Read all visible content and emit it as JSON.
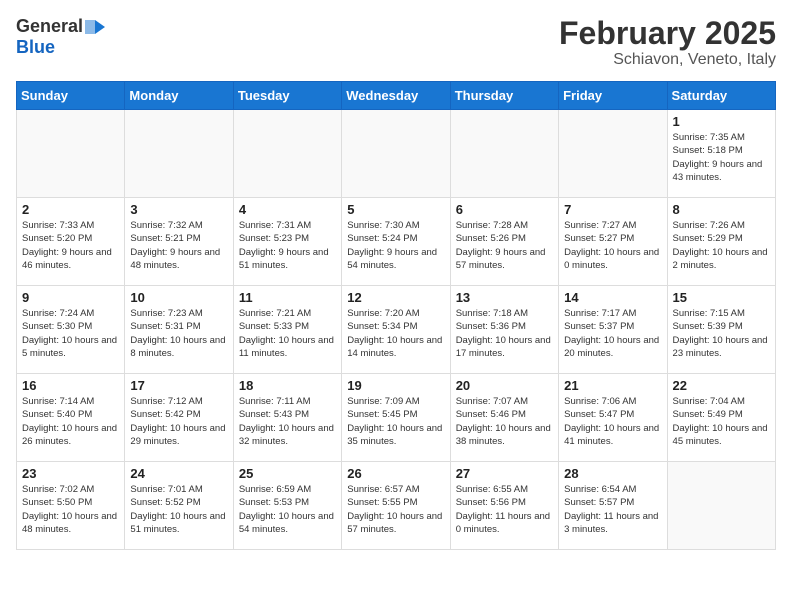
{
  "header": {
    "logo_general": "General",
    "logo_blue": "Blue",
    "month_title": "February 2025",
    "subtitle": "Schiavon, Veneto, Italy"
  },
  "days_of_week": [
    "Sunday",
    "Monday",
    "Tuesday",
    "Wednesday",
    "Thursday",
    "Friday",
    "Saturday"
  ],
  "weeks": [
    [
      {
        "day": "",
        "info": ""
      },
      {
        "day": "",
        "info": ""
      },
      {
        "day": "",
        "info": ""
      },
      {
        "day": "",
        "info": ""
      },
      {
        "day": "",
        "info": ""
      },
      {
        "day": "",
        "info": ""
      },
      {
        "day": "1",
        "info": "Sunrise: 7:35 AM\nSunset: 5:18 PM\nDaylight: 9 hours and 43 minutes."
      }
    ],
    [
      {
        "day": "2",
        "info": "Sunrise: 7:33 AM\nSunset: 5:20 PM\nDaylight: 9 hours and 46 minutes."
      },
      {
        "day": "3",
        "info": "Sunrise: 7:32 AM\nSunset: 5:21 PM\nDaylight: 9 hours and 48 minutes."
      },
      {
        "day": "4",
        "info": "Sunrise: 7:31 AM\nSunset: 5:23 PM\nDaylight: 9 hours and 51 minutes."
      },
      {
        "day": "5",
        "info": "Sunrise: 7:30 AM\nSunset: 5:24 PM\nDaylight: 9 hours and 54 minutes."
      },
      {
        "day": "6",
        "info": "Sunrise: 7:28 AM\nSunset: 5:26 PM\nDaylight: 9 hours and 57 minutes."
      },
      {
        "day": "7",
        "info": "Sunrise: 7:27 AM\nSunset: 5:27 PM\nDaylight: 10 hours and 0 minutes."
      },
      {
        "day": "8",
        "info": "Sunrise: 7:26 AM\nSunset: 5:29 PM\nDaylight: 10 hours and 2 minutes."
      }
    ],
    [
      {
        "day": "9",
        "info": "Sunrise: 7:24 AM\nSunset: 5:30 PM\nDaylight: 10 hours and 5 minutes."
      },
      {
        "day": "10",
        "info": "Sunrise: 7:23 AM\nSunset: 5:31 PM\nDaylight: 10 hours and 8 minutes."
      },
      {
        "day": "11",
        "info": "Sunrise: 7:21 AM\nSunset: 5:33 PM\nDaylight: 10 hours and 11 minutes."
      },
      {
        "day": "12",
        "info": "Sunrise: 7:20 AM\nSunset: 5:34 PM\nDaylight: 10 hours and 14 minutes."
      },
      {
        "day": "13",
        "info": "Sunrise: 7:18 AM\nSunset: 5:36 PM\nDaylight: 10 hours and 17 minutes."
      },
      {
        "day": "14",
        "info": "Sunrise: 7:17 AM\nSunset: 5:37 PM\nDaylight: 10 hours and 20 minutes."
      },
      {
        "day": "15",
        "info": "Sunrise: 7:15 AM\nSunset: 5:39 PM\nDaylight: 10 hours and 23 minutes."
      }
    ],
    [
      {
        "day": "16",
        "info": "Sunrise: 7:14 AM\nSunset: 5:40 PM\nDaylight: 10 hours and 26 minutes."
      },
      {
        "day": "17",
        "info": "Sunrise: 7:12 AM\nSunset: 5:42 PM\nDaylight: 10 hours and 29 minutes."
      },
      {
        "day": "18",
        "info": "Sunrise: 7:11 AM\nSunset: 5:43 PM\nDaylight: 10 hours and 32 minutes."
      },
      {
        "day": "19",
        "info": "Sunrise: 7:09 AM\nSunset: 5:45 PM\nDaylight: 10 hours and 35 minutes."
      },
      {
        "day": "20",
        "info": "Sunrise: 7:07 AM\nSunset: 5:46 PM\nDaylight: 10 hours and 38 minutes."
      },
      {
        "day": "21",
        "info": "Sunrise: 7:06 AM\nSunset: 5:47 PM\nDaylight: 10 hours and 41 minutes."
      },
      {
        "day": "22",
        "info": "Sunrise: 7:04 AM\nSunset: 5:49 PM\nDaylight: 10 hours and 45 minutes."
      }
    ],
    [
      {
        "day": "23",
        "info": "Sunrise: 7:02 AM\nSunset: 5:50 PM\nDaylight: 10 hours and 48 minutes."
      },
      {
        "day": "24",
        "info": "Sunrise: 7:01 AM\nSunset: 5:52 PM\nDaylight: 10 hours and 51 minutes."
      },
      {
        "day": "25",
        "info": "Sunrise: 6:59 AM\nSunset: 5:53 PM\nDaylight: 10 hours and 54 minutes."
      },
      {
        "day": "26",
        "info": "Sunrise: 6:57 AM\nSunset: 5:55 PM\nDaylight: 10 hours and 57 minutes."
      },
      {
        "day": "27",
        "info": "Sunrise: 6:55 AM\nSunset: 5:56 PM\nDaylight: 11 hours and 0 minutes."
      },
      {
        "day": "28",
        "info": "Sunrise: 6:54 AM\nSunset: 5:57 PM\nDaylight: 11 hours and 3 minutes."
      },
      {
        "day": "",
        "info": ""
      }
    ]
  ]
}
